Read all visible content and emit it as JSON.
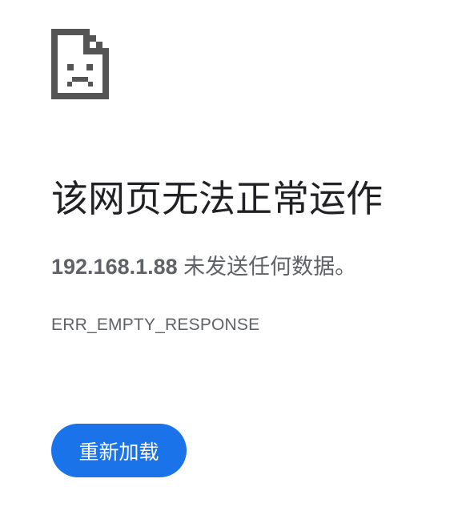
{
  "icon": "sad-page-icon",
  "title": "该网页无法正常运作",
  "summary": {
    "host": "192.168.1.88",
    "message": " 未发送任何数据。"
  },
  "error_code": "ERR_EMPTY_RESPONSE",
  "reload_button": "重新加载",
  "colors": {
    "title": "#202124",
    "secondary_text": "#5f6368",
    "button_bg": "#1a73e8",
    "button_text": "#ffffff",
    "icon": "#555555"
  }
}
